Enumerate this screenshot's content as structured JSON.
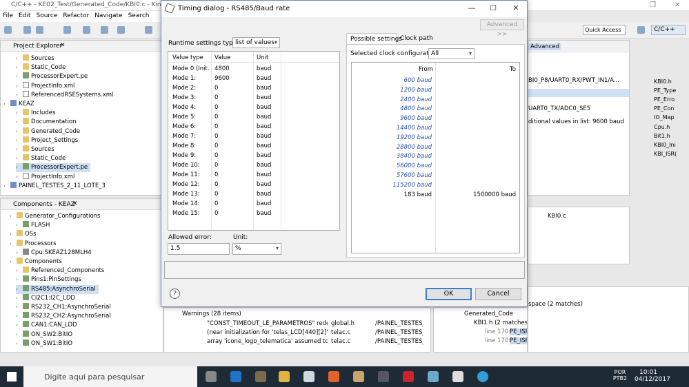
{
  "ide": {
    "window_title": "C/C++ - KE02_Test/Generated_Code/KBI0.c - Kinetis Desi",
    "menu": [
      "File",
      "Edit",
      "Source",
      "Refactor",
      "Navigate",
      "Search"
    ],
    "quick_access": "Quick Access",
    "perspective": "C/C++",
    "project_explorer": {
      "title": "Project Explorer",
      "items": [
        {
          "label": "Sources",
          "indent": 2,
          "icon": "folder"
        },
        {
          "label": "Static_Code",
          "indent": 2,
          "icon": "folder"
        },
        {
          "label": "ProcessorExpert.pe",
          "indent": 2,
          "icon": "pe"
        },
        {
          "label": "ProjectInfo.xml",
          "indent": 2,
          "icon": "file"
        },
        {
          "label": "ReferencedRSESystems.xml",
          "indent": 2,
          "icon": "file"
        },
        {
          "label": "KEAZ",
          "indent": 0,
          "icon": "proj"
        },
        {
          "label": "Includes",
          "indent": 2,
          "icon": "folder"
        },
        {
          "label": "Documentation",
          "indent": 2,
          "icon": "folder"
        },
        {
          "label": "Generated_Code",
          "indent": 2,
          "icon": "folder"
        },
        {
          "label": "Project_Settings",
          "indent": 2,
          "icon": "folder"
        },
        {
          "label": "Sources",
          "indent": 2,
          "icon": "folder"
        },
        {
          "label": "Static_Code",
          "indent": 2,
          "icon": "folder"
        },
        {
          "label": "ProcessorExpert.pe",
          "indent": 2,
          "icon": "pe",
          "selected": true
        },
        {
          "label": "ProjectInfo.xml",
          "indent": 2,
          "icon": "file"
        },
        {
          "label": "PAINEL_TESTES_2_11_LOTE_3",
          "indent": 0,
          "icon": "proj"
        }
      ]
    },
    "components": {
      "title": "Components - KEAZ",
      "items": [
        {
          "label": "Generator_Configurations",
          "indent": 1,
          "icon": "folder"
        },
        {
          "label": "FLASH",
          "indent": 2,
          "icon": "comp"
        },
        {
          "label": "OSs",
          "indent": 1,
          "icon": "folder"
        },
        {
          "label": "Processors",
          "indent": 1,
          "icon": "folder"
        },
        {
          "label": "Cpu:SKEAZ128MLH4",
          "indent": 2,
          "icon": "cpu"
        },
        {
          "label": "Components",
          "indent": 1,
          "icon": "folder"
        },
        {
          "label": "Referenced_Components",
          "indent": 2,
          "icon": "folder"
        },
        {
          "label": "Pins1:PinSettings",
          "indent": 2,
          "icon": "comp"
        },
        {
          "label": "RS485:AsynchroSerial",
          "indent": 2,
          "icon": "comp",
          "selected": true
        },
        {
          "label": "CI2C1:I2C_LDD",
          "indent": 2,
          "icon": "comp"
        },
        {
          "label": "RS232_CH1:AsynchroSerial",
          "indent": 2,
          "icon": "comp"
        },
        {
          "label": "RS232_CH2:AsynchroSerial",
          "indent": 2,
          "icon": "comp"
        },
        {
          "label": "CAN1:CAN_LDD",
          "indent": 2,
          "icon": "comp"
        },
        {
          "label": "ON_SW2:BitIO",
          "indent": 2,
          "icon": "comp"
        },
        {
          "label": "ON_SW1:BitIO",
          "indent": 2,
          "icon": "comp"
        }
      ]
    },
    "middle": {
      "advanced_label": "Advanced",
      "pin_line": "BI0_P8/UART0_RX/PWT_IN1/A...",
      "pin_line2": "UART0_TX/ADC0_SE5",
      "info_line": "ditional values in list: 9600 baud",
      "editor_tab": "KBI0.c",
      "search_label": "space (2 matches)"
    },
    "outline": [
      "KBI0.h",
      "PE_Type",
      "PE_Erro",
      "PE_Con",
      "IO_Map",
      "Cpu.h",
      "Bit1.h",
      "KBI0_Ini",
      "KBI_ISR("
    ],
    "problems": {
      "warnings_label": "Warnings (28 items)",
      "rows": [
        {
          "desc": "\"CONST_TIMEOUT_LE_PARAMETROS\" redefi",
          "res": "global.h",
          "path": "/PAINEL_TESTES_"
        },
        {
          "desc": "(near initialization for 'telas_LCD[440][2]') [en",
          "res": "telac.c",
          "path": "/PAINEL_TESTES_"
        },
        {
          "desc": "array 'icone_logo_telematica' assumed to hav",
          "res": "telac.c",
          "path": "/PAINEL_TESTES_"
        }
      ]
    },
    "search": {
      "folder": "Generated_Code",
      "file": "KBI1.h (2 matches)",
      "lines": [
        {
          "prefix": "line 170:",
          "text": "PE_ISR(EventKBI1);"
        },
        {
          "prefix": "line 170:",
          "text": "PE_ISR(EventKBI1);"
        }
      ]
    },
    "taskbar": {
      "search_placeholder": "Digite aqui para pesquisar",
      "lang1": "POR",
      "lang2": "PTB2",
      "time": "10:01",
      "date": "04/12/2017"
    }
  },
  "dialog": {
    "title": "Timing dialog - RS485/Baud rate",
    "advanced_button": "Advanced >>",
    "runtime_label": "Runtime settings type:",
    "runtime_value": "list of values",
    "columns": [
      "Value type",
      "Value",
      "Unit"
    ],
    "modes": [
      {
        "type": "Mode 0 (Init...",
        "value": "4800",
        "unit": "baud"
      },
      {
        "type": "Mode 1:",
        "value": "9600",
        "unit": "baud"
      },
      {
        "type": "Mode 2:",
        "value": "0",
        "unit": "baud"
      },
      {
        "type": "Mode 3:",
        "value": "0",
        "unit": "baud"
      },
      {
        "type": "Mode 4:",
        "value": "0",
        "unit": "baud"
      },
      {
        "type": "Mode 5:",
        "value": "0",
        "unit": "baud"
      },
      {
        "type": "Mode 6:",
        "value": "0",
        "unit": "baud"
      },
      {
        "type": "Mode 7:",
        "value": "0",
        "unit": "baud"
      },
      {
        "type": "Mode 8:",
        "value": "0",
        "unit": "baud"
      },
      {
        "type": "Mode 9:",
        "value": "0",
        "unit": "baud"
      },
      {
        "type": "Mode 10:",
        "value": "0",
        "unit": "baud"
      },
      {
        "type": "Mode 11:",
        "value": "0",
        "unit": "baud"
      },
      {
        "type": "Mode 12:",
        "value": "0",
        "unit": "baud"
      },
      {
        "type": "Mode 13:",
        "value": "0",
        "unit": "baud"
      },
      {
        "type": "Mode 14:",
        "value": "0",
        "unit": "baud"
      },
      {
        "type": "Mode 15:",
        "value": "0",
        "unit": "baud"
      }
    ],
    "allowed_error_label": "Allowed error:",
    "allowed_error_value": "1.5",
    "unit_label": "Unit:",
    "unit_value": "%",
    "tabs": [
      "Possible settings",
      "Clock path"
    ],
    "clock_config_label": "Selected clock configuration",
    "clock_config_value": "All",
    "clock_columns": [
      "From",
      "To"
    ],
    "possible_values": [
      "600 baud",
      "1200 baud",
      "2400 baud",
      "4800 baud",
      "9600 baud",
      "14400 baud",
      "19200 baud",
      "28800 baud",
      "38400 baud",
      "56000 baud",
      "57600 baud",
      "115200 baud"
    ],
    "range_row": {
      "from": "183 baud",
      "to": "1500000 baud"
    },
    "ok_label": "OK",
    "cancel_label": "Cancel",
    "colors": {
      "accent": "#3b7ed0",
      "possible_value": "#2a4fa8"
    }
  }
}
